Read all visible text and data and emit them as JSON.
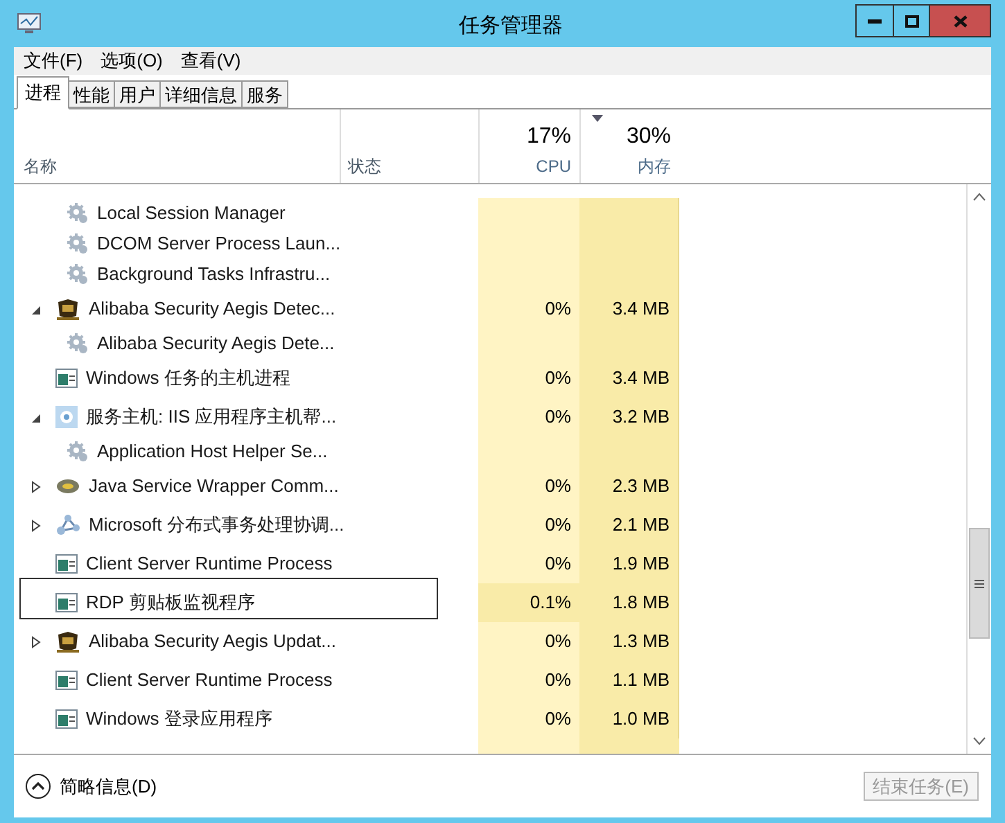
{
  "window": {
    "title": "任务管理器"
  },
  "menu": [
    "文件(F)",
    "选项(O)",
    "查看(V)"
  ],
  "tabs": [
    {
      "label": "进程",
      "selected": true
    },
    {
      "label": "性能",
      "selected": false
    },
    {
      "label": "用户",
      "selected": false
    },
    {
      "label": "详细信息",
      "selected": false
    },
    {
      "label": "服务",
      "selected": false
    }
  ],
  "columns": [
    {
      "kind": "name",
      "label": "名称",
      "sorted": false
    },
    {
      "kind": "status",
      "label": "状态",
      "sorted": false
    },
    {
      "kind": "cpu",
      "total": "17%",
      "label": "CPU",
      "sorted": false
    },
    {
      "kind": "memory",
      "total": "30%",
      "label": "内存",
      "sorted": true
    }
  ],
  "rows": [
    {
      "kind": "service",
      "name": "Local Session Manager",
      "selected": false
    },
    {
      "kind": "service",
      "name": "DCOM Server Process Laun...",
      "selected": false
    },
    {
      "kind": "service",
      "name": "Background Tasks Infrastru...",
      "selected": false
    },
    {
      "kind": "shield",
      "name": "Alibaba Security Aegis Detec...",
      "cpu": "0%",
      "memory": "3.4 MB",
      "expanded": true,
      "selected": false,
      "children": [
        {
          "kind": "service",
          "name": "Alibaba Security Aegis Dete...",
          "selected": false
        }
      ]
    },
    {
      "kind": "window",
      "name": "Windows 任务的主机进程",
      "cpu": "0%",
      "memory": "3.4 MB",
      "selected": false
    },
    {
      "kind": "host",
      "name": "服务主机: IIS 应用程序主机帮...",
      "cpu": "0%",
      "memory": "3.2 MB",
      "expanded": true,
      "selected": false,
      "children": [
        {
          "kind": "service",
          "name": "Application Host Helper Se...",
          "selected": false
        }
      ]
    },
    {
      "kind": "java",
      "name": "Java Service Wrapper Comm...",
      "cpu": "0%",
      "memory": "2.3 MB",
      "expanded": false,
      "selected": false
    },
    {
      "kind": "network",
      "name": "Microsoft 分布式事务处理协调...",
      "cpu": "0%",
      "memory": "2.1 MB",
      "expanded": false,
      "selected": false
    },
    {
      "kind": "window",
      "name": "Client Server Runtime Process",
      "cpu": "0%",
      "memory": "1.9 MB",
      "selected": false
    },
    {
      "kind": "window",
      "name": "RDP 剪贴板监视程序",
      "cpu": "0.1%",
      "memory": "1.8 MB",
      "selected": true
    },
    {
      "kind": "shield",
      "name": "Alibaba Security Aegis Updat...",
      "cpu": "0%",
      "memory": "1.3 MB",
      "expanded": false,
      "selected": false
    },
    {
      "kind": "window",
      "name": "Client Server Runtime Process",
      "cpu": "0%",
      "memory": "1.1 MB",
      "selected": false
    },
    {
      "kind": "window",
      "name": "Windows 登录应用程序",
      "cpu": "0%",
      "memory": "1.0 MB",
      "selected": false
    }
  ],
  "footer": {
    "details_toggle": "简略信息(D)",
    "end_task": {
      "label": "结束任务(E)",
      "disabled": true
    }
  }
}
